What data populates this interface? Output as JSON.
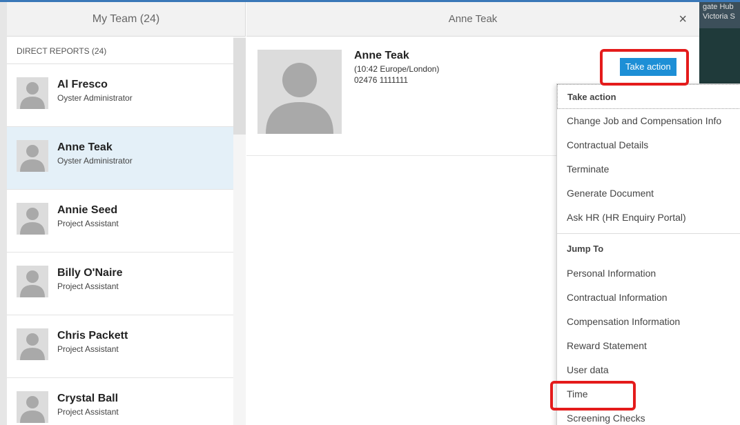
{
  "left_panel": {
    "title": "My Team (24)",
    "section_label": "DIRECT REPORTS (24)",
    "people": [
      {
        "name": "Al Fresco",
        "role": "Oyster Administrator"
      },
      {
        "name": "Anne Teak",
        "role": "Oyster Administrator"
      },
      {
        "name": "Annie Seed",
        "role": "Project Assistant"
      },
      {
        "name": "Billy O'Naire",
        "role": "Project Assistant"
      },
      {
        "name": "Chris Packett",
        "role": "Project Assistant"
      },
      {
        "name": "Crystal Ball",
        "role": "Project Assistant"
      }
    ],
    "selected_index": 1
  },
  "detail": {
    "header_title": "Anne Teak",
    "close_label": "×",
    "name": "Anne Teak",
    "timezone": "(10:42 Europe/London)",
    "phone": "02476 1111111",
    "take_action_label": "Take action"
  },
  "menu": {
    "header": "Take action",
    "actions": [
      "Change Job and Compensation Info",
      "Contractual Details",
      "Terminate",
      "Generate Document",
      "Ask HR (HR Enquiry Portal)"
    ],
    "jump_label": "Jump To",
    "jump_items": [
      "Personal Information",
      "Contractual Information",
      "Compensation Information",
      "Reward Statement",
      "User data",
      "Time",
      "Screening Checks"
    ]
  },
  "background": {
    "line1": "gate Hub",
    "line2": "Victoria S"
  },
  "colors": {
    "accent": "#1d8fd6",
    "highlight": "#e41b1b",
    "selected_row": "#e4f0f8"
  }
}
